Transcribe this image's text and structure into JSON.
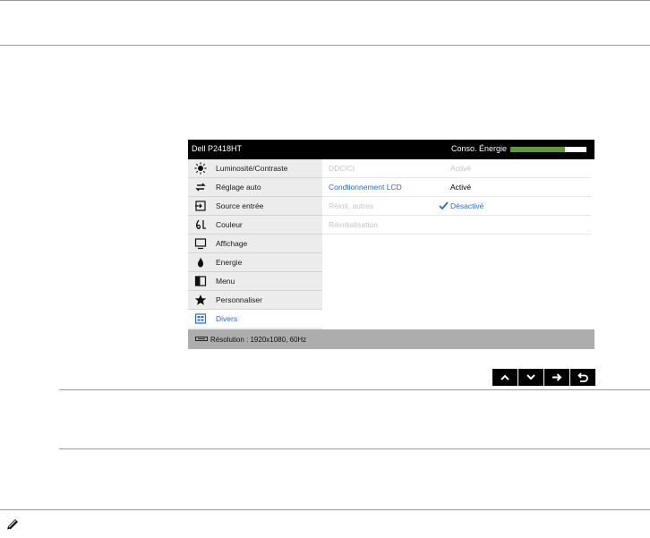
{
  "osd": {
    "title": "Dell P2418HT",
    "energy_label": "Conso. Énergie",
    "energy_level_percent": 72,
    "menu": [
      {
        "label": "Luminosité/Contraste",
        "icon": "sun-icon"
      },
      {
        "label": "Réglage auto",
        "icon": "auto-adjust-icon"
      },
      {
        "label": "Source entrée",
        "icon": "input-source-icon"
      },
      {
        "label": "Couleur",
        "icon": "color-icon"
      },
      {
        "label": "Affichage",
        "icon": "display-icon"
      },
      {
        "label": "Energie",
        "icon": "energy-icon"
      },
      {
        "label": "Menu",
        "icon": "menu-icon"
      },
      {
        "label": "Personnaliser",
        "icon": "star-icon"
      },
      {
        "label": "Divers",
        "icon": "others-icon"
      }
    ],
    "selected_menu": "Divers",
    "options": [
      {
        "name": "DDC/CI",
        "value": "Activé"
      },
      {
        "name": "Condtionnement LCD",
        "value": "Activé"
      },
      {
        "name": "Réinit. autres",
        "value": "Désactivé"
      },
      {
        "name": "Réinitialisation",
        "value": ""
      }
    ],
    "footer": {
      "resolution": "Résolution : 1920x1080, 60Hz"
    },
    "nav_buttons": [
      "up-arrow-icon",
      "down-arrow-icon",
      "right-arrow-icon",
      "back-icon"
    ]
  },
  "colors": {
    "header_bg": "#000000",
    "energy_fill": "#5c9a3b",
    "menu_bg": "#ececec",
    "selected_blue": "#2a6fc0",
    "footer_bg": "#adadad"
  },
  "icons": {
    "note": "pencil-note-icon"
  }
}
